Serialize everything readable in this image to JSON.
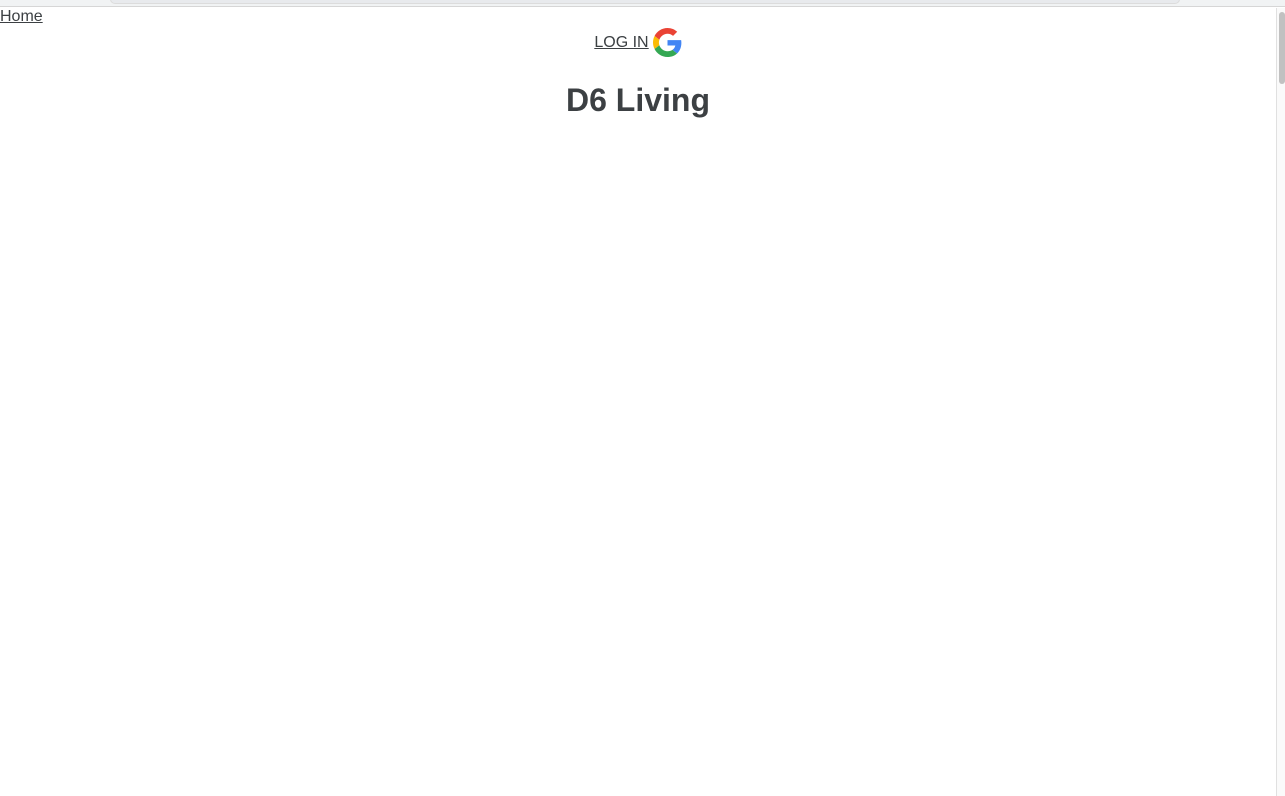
{
  "nav": {
    "home_label": "Home"
  },
  "auth": {
    "login_label": "LOG IN",
    "provider_icon": "google-icon"
  },
  "page": {
    "title": "D6 Living"
  },
  "colors": {
    "text": "#3c4043",
    "google_blue": "#4285F4",
    "google_red": "#EA4335",
    "google_yellow": "#FBBC05",
    "google_green": "#34A853"
  }
}
